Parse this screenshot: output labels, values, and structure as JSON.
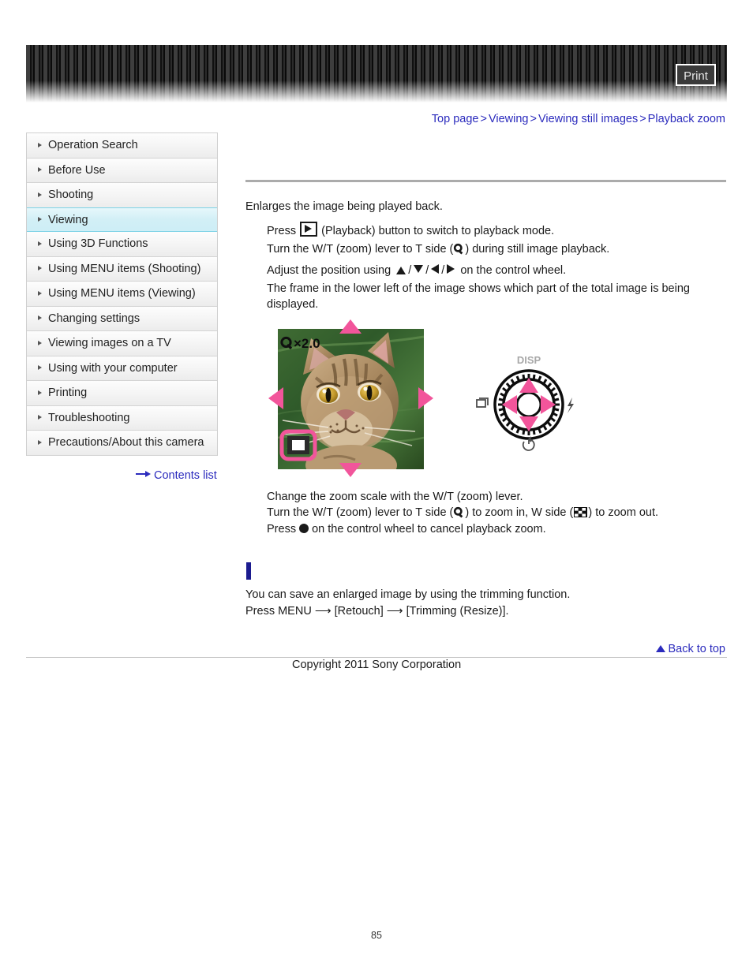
{
  "header": {
    "print_label": "Print"
  },
  "breadcrumb": {
    "separator": ">",
    "items": [
      {
        "label": "Top page"
      },
      {
        "label": "Viewing"
      },
      {
        "label": "Viewing still images"
      },
      {
        "label": "Playback zoom"
      }
    ]
  },
  "sidebar": {
    "items": [
      {
        "label": "Operation Search",
        "active": false
      },
      {
        "label": "Before Use",
        "active": false
      },
      {
        "label": "Shooting",
        "active": false
      },
      {
        "label": "Viewing",
        "active": true
      },
      {
        "label": "Using 3D Functions",
        "active": false
      },
      {
        "label": "Using MENU items (Shooting)",
        "active": false
      },
      {
        "label": "Using MENU items (Viewing)",
        "active": false
      },
      {
        "label": "Changing settings",
        "active": false
      },
      {
        "label": "Viewing images on a TV",
        "active": false
      },
      {
        "label": "Using with your computer",
        "active": false
      },
      {
        "label": "Printing",
        "active": false
      },
      {
        "label": "Troubleshooting",
        "active": false
      },
      {
        "label": "Precautions/About this camera",
        "active": false
      }
    ],
    "contents_list_label": "Contents list"
  },
  "main": {
    "intro": "Enlarges the image being played back.",
    "step1_before": "Press",
    "step1_after": "(Playback) button to switch to playback mode.",
    "step2_before": "Turn the W/T (zoom) lever to T side (",
    "step2_after": ") during still image playback.",
    "step3_before": "Adjust the position using",
    "step3_sep": "/",
    "step3_after": "on the control wheel.",
    "step4": "The frame in the lower left of the image shows which part of the total image is being displayed.",
    "after1": "Change the zoom scale with the W/T (zoom) lever.",
    "after2_a": "Turn the W/T (zoom) lever to T side (",
    "after2_b": ") to zoom in, W side (",
    "after2_c": ") to zoom out.",
    "after3_before": "Press",
    "after3_after": "on the control wheel to cancel playback zoom.",
    "hint1": "You can save an enlarged image by using the trimming function.",
    "hint2_a": "Press MENU",
    "hint2_arrow": "⟶",
    "hint2_b": "[Retouch]",
    "hint2_c": "[Trimming (Resize)]."
  },
  "figure": {
    "zoom_label": "Q×2.0",
    "wheel_top_label": "DISP",
    "alt": "Camera screen showing enlarged cat photo with direction arrows and control wheel diagram"
  },
  "footer": {
    "back_to_top": "Back to top",
    "copyright": "Copyright 2011 Sony Corporation",
    "page_number": "85"
  },
  "colors": {
    "link": "#2b2bbd",
    "accent_pink": "#f2559b",
    "active_nav": "#cdeef6",
    "rule": "#ababab",
    "marker": "#1b1b8f"
  }
}
